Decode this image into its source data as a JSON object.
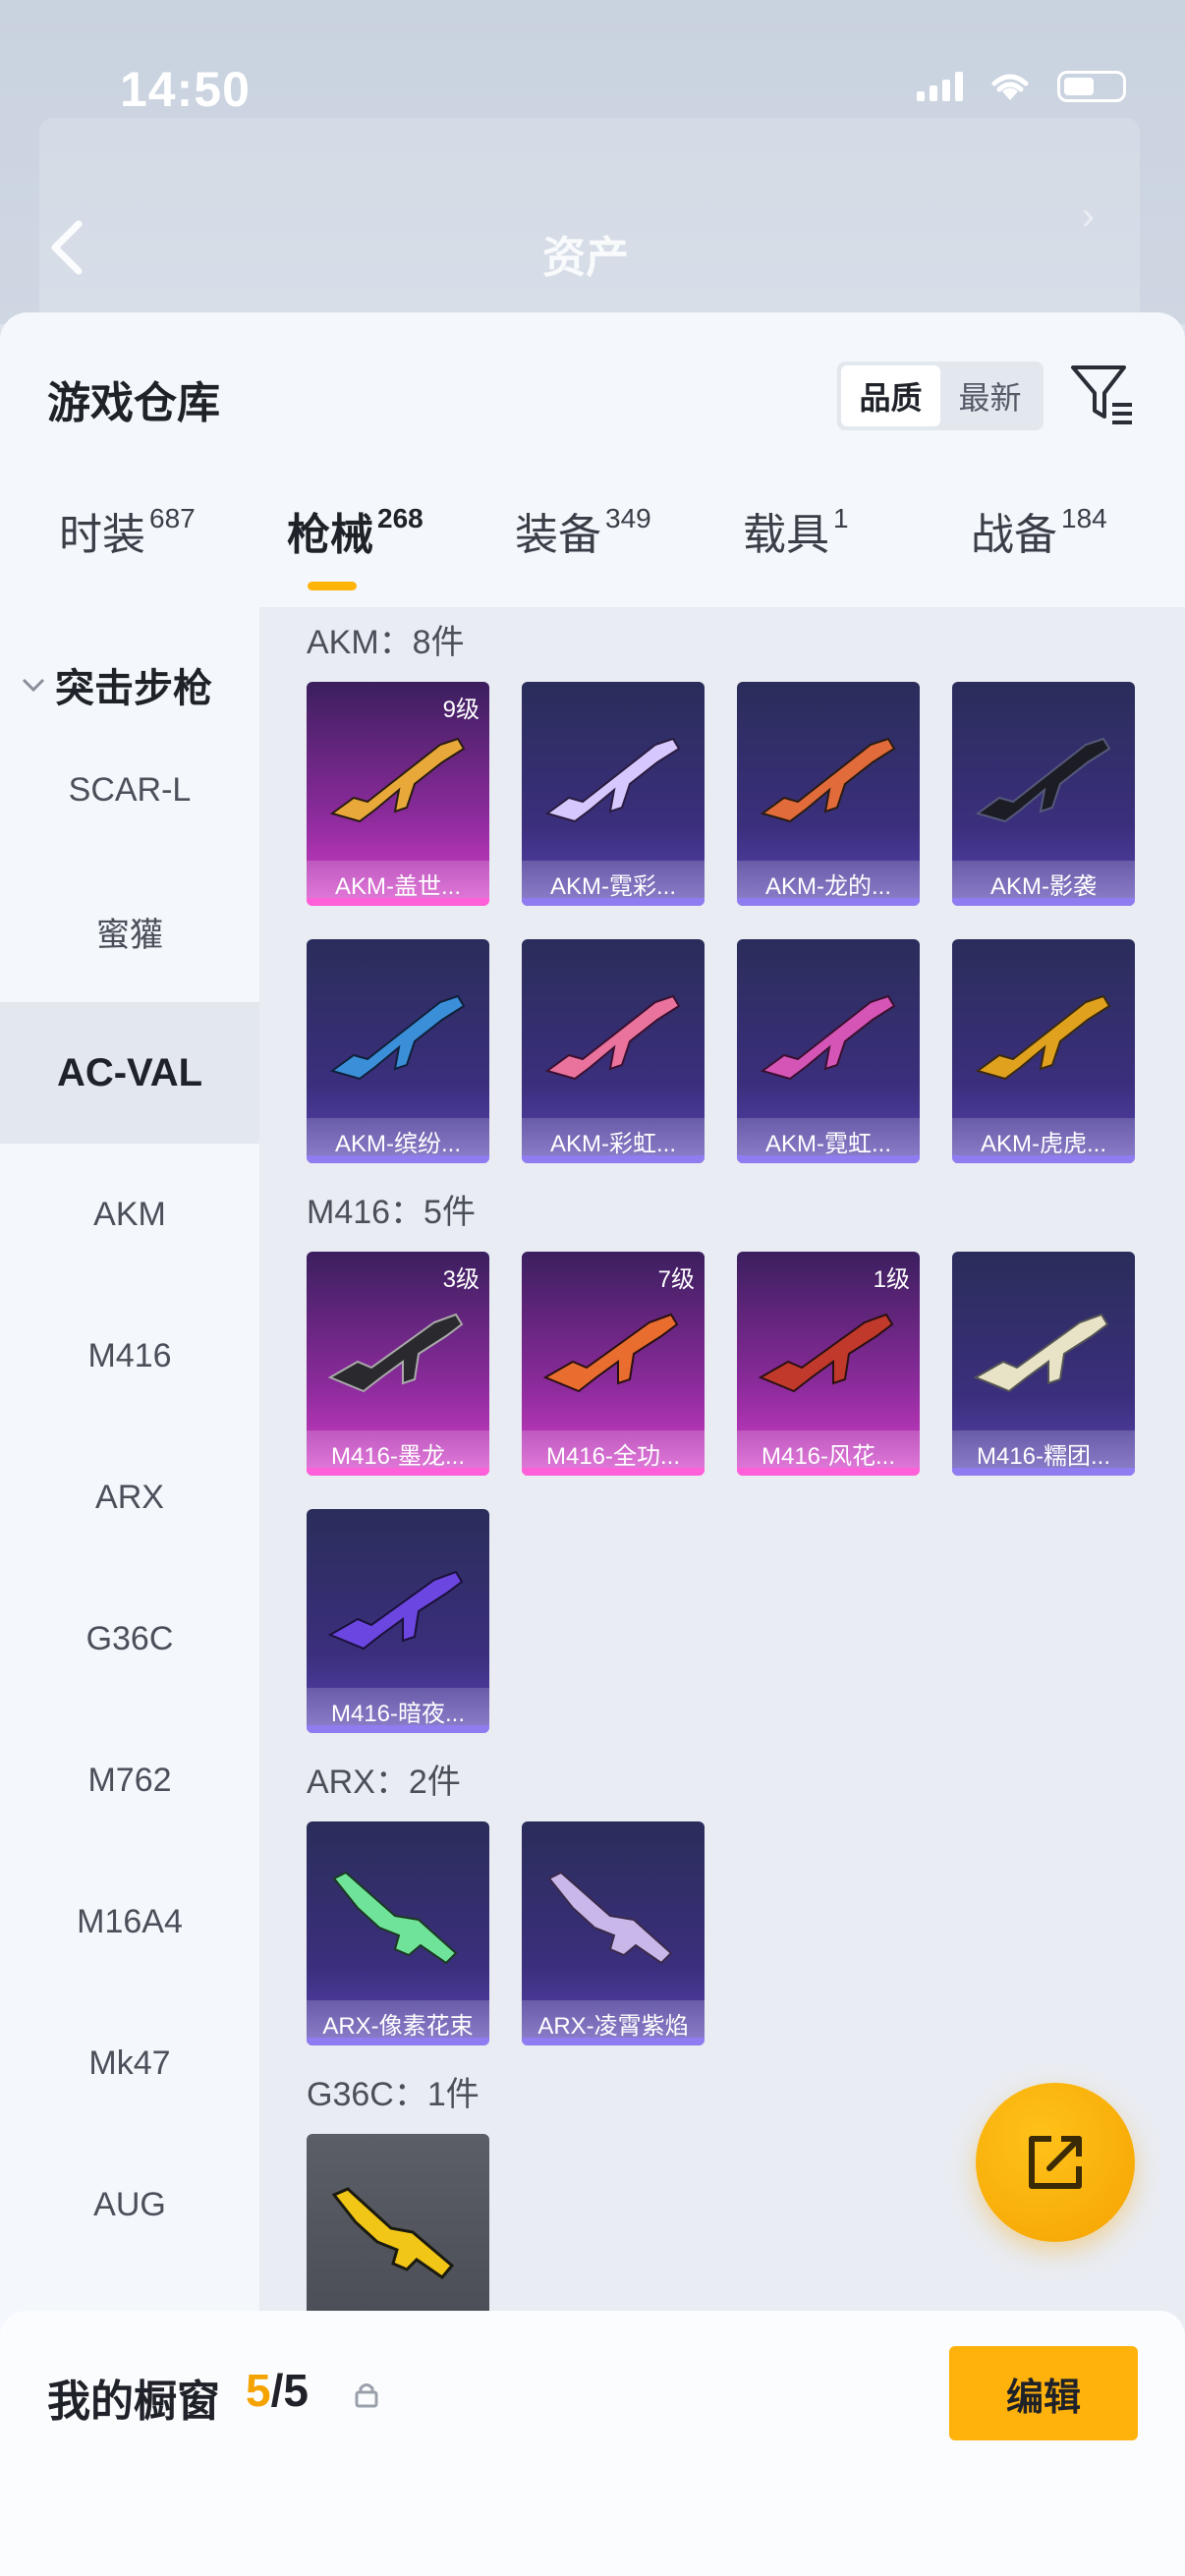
{
  "status_bar": {
    "time": "14:50"
  },
  "header": {
    "title": "资产"
  },
  "warehouse": {
    "title": "游戏仓库",
    "sort_options": [
      "品质",
      "最新"
    ],
    "sort_selected": "品质"
  },
  "tabs": [
    {
      "label": "时装",
      "count": "687"
    },
    {
      "label": "枪械",
      "count": "268"
    },
    {
      "label": "装备",
      "count": "349"
    },
    {
      "label": "载具",
      "count": "1"
    },
    {
      "label": "战备",
      "count": "184"
    }
  ],
  "sidebar": {
    "header": "突击步枪",
    "items": [
      "SCAR-L",
      "蜜獾",
      "AC-VAL",
      "AKM",
      "M416",
      "ARX",
      "G36C",
      "M762",
      "M16A4",
      "Mk47",
      "AUG"
    ],
    "selected": "AC-VAL"
  },
  "groups": [
    {
      "label": "AKM：8件",
      "items": [
        {
          "name": "AKM-盖世...",
          "level": "9级",
          "style": "pink",
          "gun_color": "#e8a93a"
        },
        {
          "name": "AKM-霓彩...",
          "level": "",
          "style": "purple",
          "gun_color": "#d6c8ff"
        },
        {
          "name": "AKM-龙的...",
          "level": "",
          "style": "purple",
          "gun_color": "#e26b3c"
        },
        {
          "name": "AKM-影袭",
          "level": "",
          "style": "purple",
          "gun_color": "#1c1d24"
        },
        {
          "name": "AKM-缤纷...",
          "level": "",
          "style": "purple",
          "gun_color": "#3b8fd8"
        },
        {
          "name": "AKM-彩虹...",
          "level": "",
          "style": "purple",
          "gun_color": "#e9739d"
        },
        {
          "name": "AKM-霓虹...",
          "level": "",
          "style": "purple",
          "gun_color": "#d455b6"
        },
        {
          "name": "AKM-虎虎...",
          "level": "",
          "style": "purple",
          "gun_color": "#e0a21e"
        }
      ]
    },
    {
      "label": "M416：5件",
      "items": [
        {
          "name": "M416-墨龙...",
          "level": "3级",
          "style": "pink",
          "gun_color": "#2a2a2e"
        },
        {
          "name": "M416-全功...",
          "level": "7级",
          "style": "pink",
          "gun_color": "#e86d2f"
        },
        {
          "name": "M416-风花...",
          "level": "1级",
          "style": "pink",
          "gun_color": "#c0392b"
        },
        {
          "name": "M416-糯团...",
          "level": "",
          "style": "purple",
          "gun_color": "#e8e3c6"
        },
        {
          "name": "M416-暗夜...",
          "level": "",
          "style": "purple",
          "gun_color": "#6b46e0"
        }
      ]
    },
    {
      "label": "ARX：2件",
      "items": [
        {
          "name": "ARX-像素花束",
          "level": "",
          "style": "purple",
          "gun_color": "#6fe39a"
        },
        {
          "name": "ARX-凌霄紫焰",
          "level": "",
          "style": "purple",
          "gun_color": "#c9b7ea"
        }
      ]
    },
    {
      "label": "G36C：1件",
      "items": [
        {
          "name": "",
          "level": "",
          "style": "gray",
          "gun_color": "#f1c616"
        }
      ]
    }
  ],
  "showcase": {
    "label": "我的橱窗",
    "current": "5",
    "total": "5",
    "edit_label": "编辑"
  },
  "colors": {
    "accent": "#ffb20c",
    "rare_pink": "#d53ec8",
    "epic_purple": "#5a44b3"
  }
}
